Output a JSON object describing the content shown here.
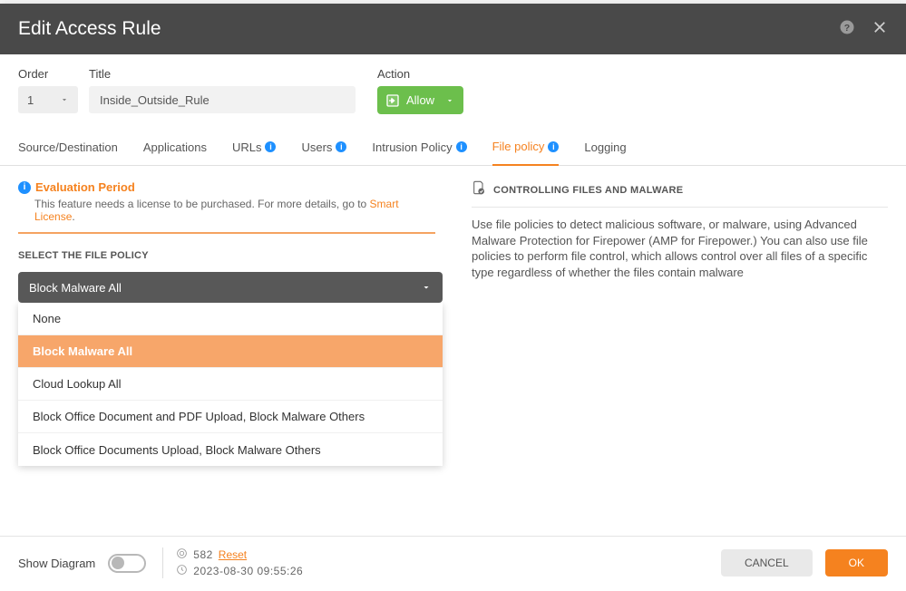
{
  "header": {
    "title": "Edit Access Rule"
  },
  "fields": {
    "order_label": "Order",
    "order_value": "1",
    "title_label": "Title",
    "title_value": "Inside_Outside_Rule",
    "action_label": "Action",
    "action_value": "Allow"
  },
  "tabs": {
    "source_dest": "Source/Destination",
    "applications": "Applications",
    "urls": "URLs",
    "users": "Users",
    "intrusion": "Intrusion Policy",
    "file_policy": "File policy",
    "logging": "Logging"
  },
  "evaluation": {
    "title": "Evaluation Period",
    "desc_prefix": "This feature needs a license to be purchased. For more details, go to ",
    "link": "Smart License",
    "desc_suffix": "."
  },
  "file_policy": {
    "label": "SELECT THE FILE POLICY",
    "selected": "Block Malware All",
    "options": [
      "None",
      "Block Malware All",
      "Cloud Lookup All",
      "Block Office Document and PDF Upload, Block Malware Others",
      "Block Office Documents Upload, Block Malware Others"
    ]
  },
  "right_panel": {
    "title": "CONTROLLING FILES AND MALWARE",
    "desc": "Use file policies to detect malicious software, or malware, using Advanced Malware Protection for Firepower (AMP for Firepower.) You can also use file policies to perform file control, which allows control over all files of a specific type regardless of whether the files contain malware"
  },
  "footer": {
    "show_diagram": "Show Diagram",
    "hit_count": "582",
    "reset": "Reset",
    "timestamp": "2023-08-30 09:55:26",
    "cancel": "CANCEL",
    "ok": "OK"
  }
}
